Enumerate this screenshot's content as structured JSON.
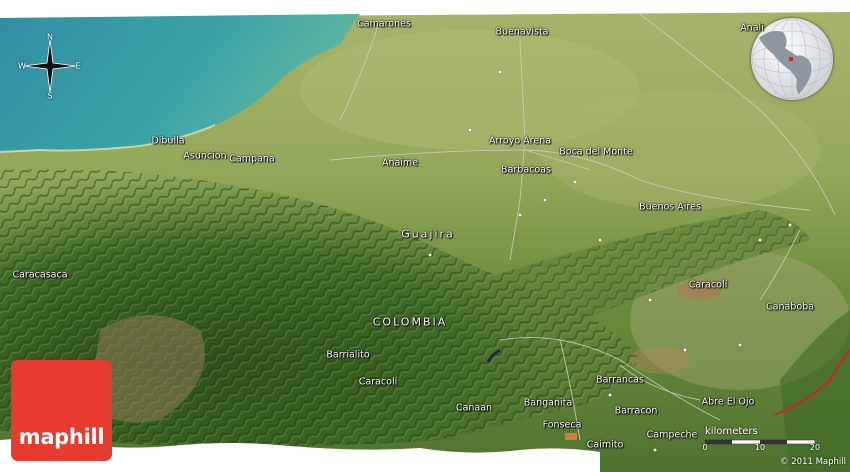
{
  "map": {
    "country_label": "COLOMBIA",
    "region_label": "Guajira",
    "logo_text": "maphill",
    "copyright": "© 2011 Maphill",
    "scale": {
      "unit": "kilometers",
      "ticks": [
        "0",
        "10",
        "20"
      ]
    },
    "compass": {
      "n": "N",
      "s": "S",
      "e": "E",
      "w": "W"
    },
    "colors": {
      "sea": "#3aa3a6",
      "lowland": "#93a85a",
      "mountains": "#3f6a25",
      "border": "#cc2233",
      "logo": "#e63b2e"
    },
    "places": [
      {
        "name": "Camarones"
      },
      {
        "name": "Buenavista"
      },
      {
        "name": "Anali"
      },
      {
        "name": "Dibulla"
      },
      {
        "name": "Asuncion"
      },
      {
        "name": "Campana"
      },
      {
        "name": "Anaime"
      },
      {
        "name": "Arroyo Arena"
      },
      {
        "name": "Barbacoas"
      },
      {
        "name": "Boca del Monte"
      },
      {
        "name": "Buenos Aires"
      },
      {
        "name": "Caracasaca"
      },
      {
        "name": "Caracolí"
      },
      {
        "name": "Canaboba"
      },
      {
        "name": "Barrialito"
      },
      {
        "name": "Caracolí"
      },
      {
        "name": "Barrancas"
      },
      {
        "name": "Canaan"
      },
      {
        "name": "Banganita"
      },
      {
        "name": "Barracon"
      },
      {
        "name": "Abre El Ojo"
      },
      {
        "name": "Fonseca"
      },
      {
        "name": "Caimito"
      },
      {
        "name": "Campeche"
      }
    ]
  }
}
